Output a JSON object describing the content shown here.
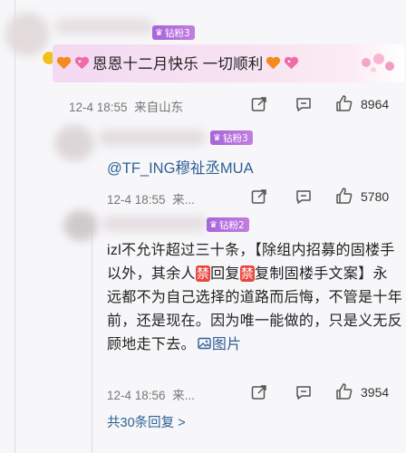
{
  "comments": [
    {
      "badge_text": "钻粉3",
      "content": "恩恩十二月快乐 一切顺利",
      "date": "12-4 18:55",
      "location": "来自山东",
      "likes": "8964"
    },
    {
      "badge_text": "钻粉3",
      "content": "@TF_ING穆祉丞MUA",
      "date": "12-4 18:55",
      "location": "来...",
      "likes": "5780"
    },
    {
      "badge_text": "钻粉2",
      "content_parts": {
        "p1": "izl不允许超过三十条，【除组内招募的固楼手以外，其余人",
        "ban1": "禁",
        "p2": "回复",
        "ban2": "禁",
        "p3": "复制固楼手文案】永远都不为自己选择的道路而后悔，不管是十年前，还是现在。因为唯一能做的，只是义无反顾地走下去。",
        "picture": "图片"
      },
      "date": "12-4 18:56",
      "location": "来...",
      "likes": "3954"
    }
  ],
  "replies_link": "共30条回复 >",
  "colors": {
    "link": "#2f5f97",
    "badge_purple": "#b86ad9",
    "ban_red": "#e8473e"
  }
}
